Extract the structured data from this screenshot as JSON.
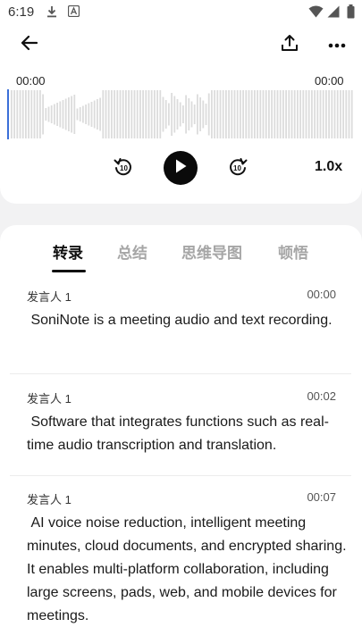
{
  "status_bar": {
    "time": "6:19"
  },
  "player": {
    "time_start": "00:00",
    "time_end": "00:00",
    "speed": "1.0x",
    "rewind_seconds": "10",
    "forward_seconds": "10"
  },
  "tabs": [
    {
      "label": "转录",
      "active": true
    },
    {
      "label": "总结",
      "active": false
    },
    {
      "label": "思维导图",
      "active": false
    },
    {
      "label": "顿悟",
      "active": false
    }
  ],
  "entries": [
    {
      "speaker": "发言人 1",
      "timestamp": "00:00",
      "text": " SoniNote is a meeting audio and text recording."
    },
    {
      "speaker": "发言人 1",
      "timestamp": "00:02",
      "text": " Software that integrates functions such as real-time audio transcription and translation."
    },
    {
      "speaker": "发言人 1",
      "timestamp": "00:07",
      "text": " AI voice noise reduction, intelligent meeting minutes, cloud documents, and encrypted sharing. It enables multi-platform collaboration, including large screens, pads, web, and mobile devices for meetings."
    }
  ],
  "colors": {
    "background": "#f2f2f3",
    "card": "#ffffff",
    "text": "#1a1a1a",
    "tab_inactive": "#a6a6a6",
    "playhead": "#3b6fd8",
    "wave": "#dcdcdc"
  }
}
